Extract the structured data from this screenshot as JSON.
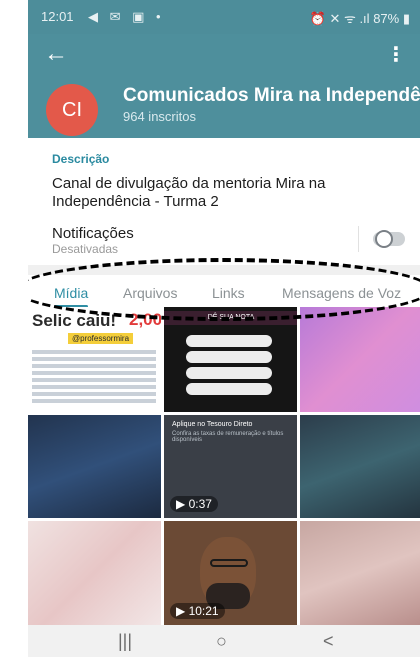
{
  "status_bar": {
    "time": "12:01",
    "left_icons": "◀ ✉ ▣ •",
    "right_icons": "⏰ ✕ ᯤ .ıl",
    "battery": "87%"
  },
  "header": {
    "back_icon": "arrow-left-icon",
    "menu_icon": "more-vertical-icon",
    "avatar_initials": "CI",
    "avatar_color": "#e3594a",
    "title": "Comunicados Mira na Independê",
    "subtitle": "964 inscritos",
    "bar_color": "#4e8f9c"
  },
  "info": {
    "description_label": "Descrição",
    "description_text": "Canal de divulgação da mentoria Mira na Independência - Turma 2",
    "notifications_label": "Notificações",
    "notifications_status": "Desativadas",
    "notifications_enabled": false
  },
  "tabs": [
    {
      "label": "Mídia",
      "active": true
    },
    {
      "label": "Arquivos",
      "active": false
    },
    {
      "label": "Links",
      "active": false
    },
    {
      "label": "Mensagens de Voz",
      "active": false
    }
  ],
  "media": {
    "selic_title": "Selic caiu!",
    "selic_value": "2,00%",
    "selic_handle": "@professormira",
    "quiz_title": "DÊ SUA NOTA",
    "article_title": "Aplique no Tesouro Direto",
    "article_sub": "Confira as taxas de remuneração e títulos disponíveis",
    "video_1_duration": "0:37",
    "video_2_duration": "10:21"
  },
  "nav_bar": {
    "recents": "|||",
    "home": "○",
    "back": "<"
  },
  "accent_color": "#2f8ea4"
}
